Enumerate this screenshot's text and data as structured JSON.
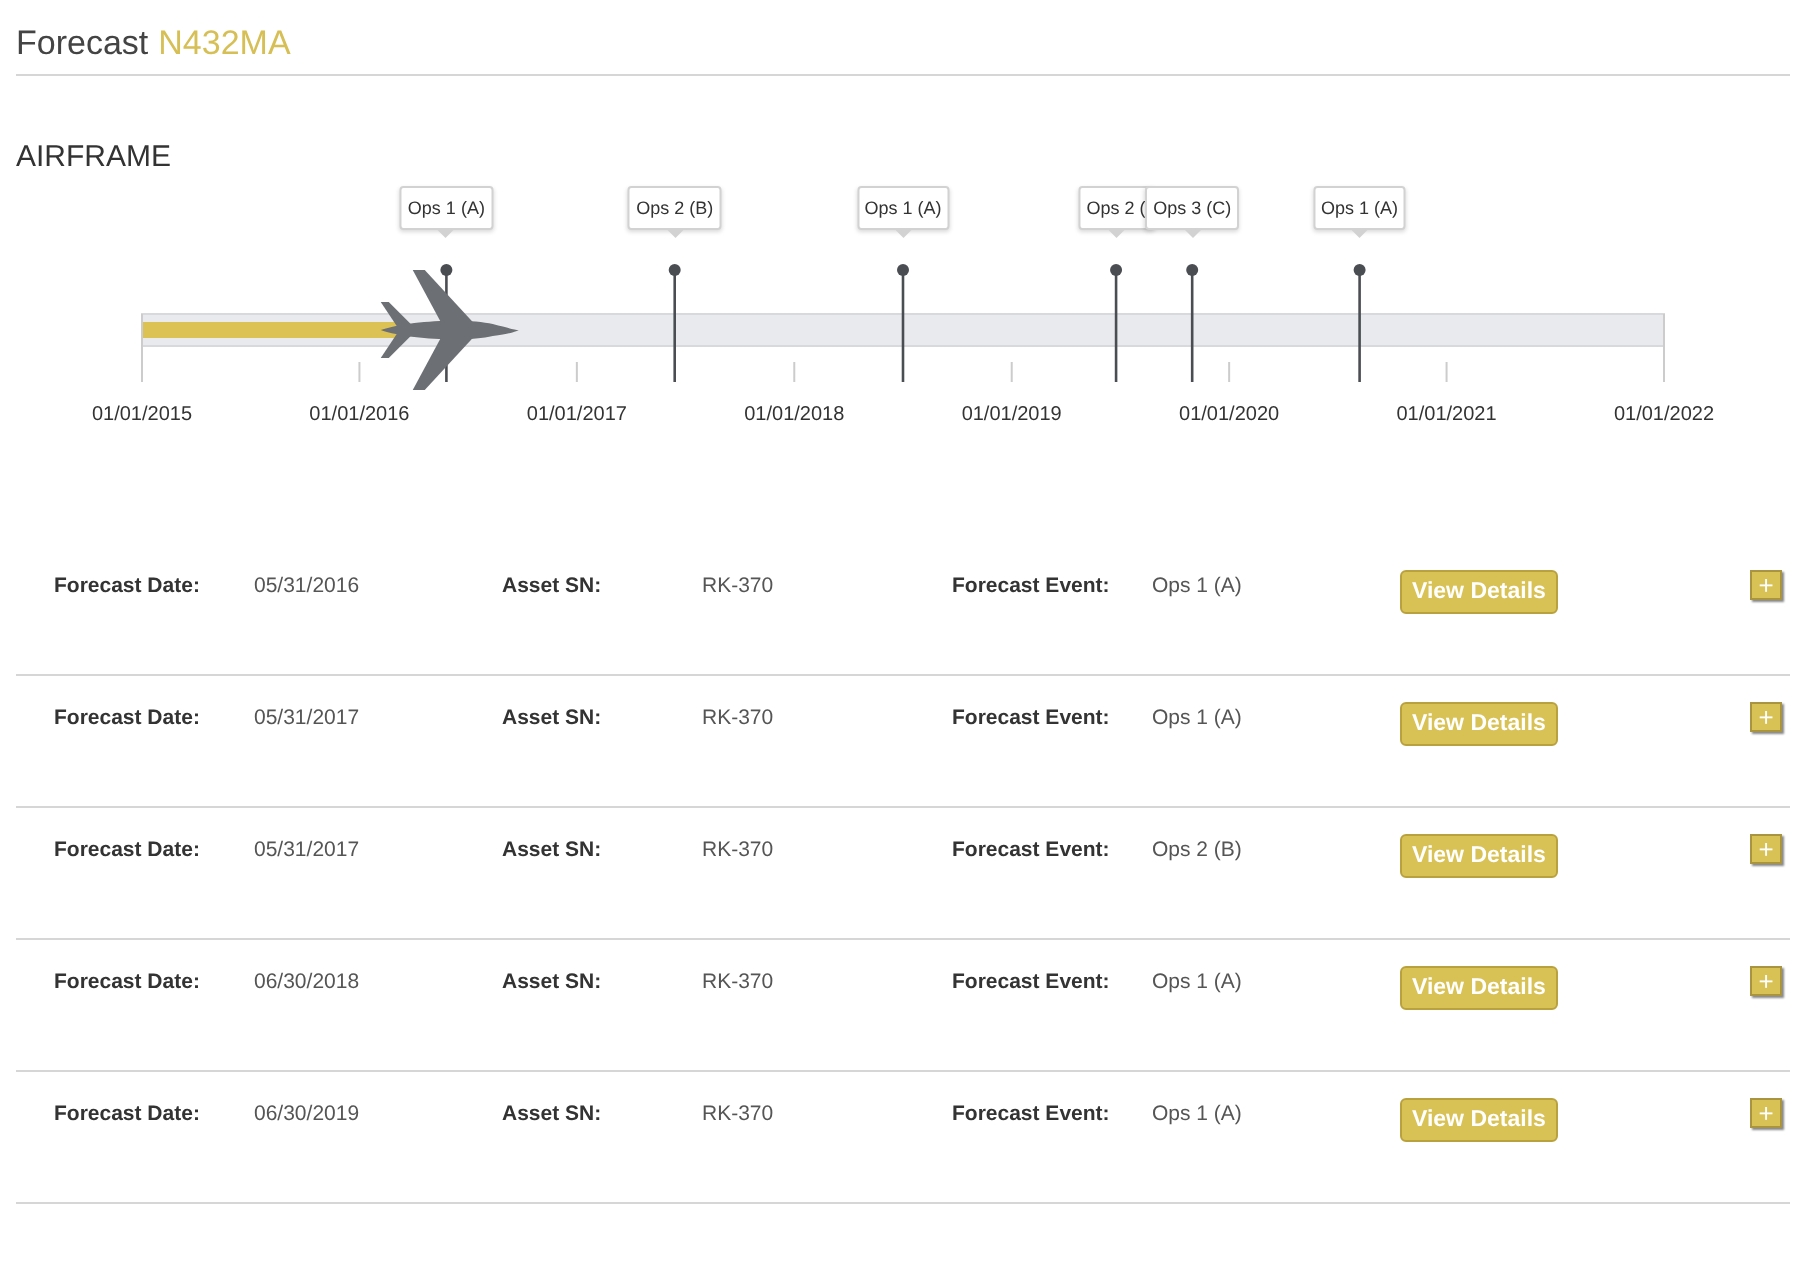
{
  "header": {
    "title": "Forecast",
    "tail_number": "N432MA"
  },
  "section": {
    "title": "AIRFRAME"
  },
  "timeline": {
    "progress": {
      "level": 0.17
    },
    "ticks": [
      "01/01/2015",
      "01/01/2016",
      "01/01/2017",
      "01/01/2018",
      "01/01/2019",
      "01/01/2020",
      "01/01/2021",
      "01/01/2022"
    ],
    "events": [
      {
        "label": "Ops 1 (A)",
        "level": 0.2
      },
      {
        "label": "Ops 2 (B)",
        "level": 0.35
      },
      {
        "label": "Ops 1 (A)",
        "level": 0.5
      },
      {
        "label": "Ops 2 (",
        "level": 0.64
      },
      {
        "label": "Ops 3 (C)",
        "level": 0.69
      },
      {
        "label": "Ops 1 (A)",
        "level": 0.8
      }
    ]
  },
  "rows": [
    {
      "date_label": "Forecast Date:",
      "date": "05/31/2016",
      "asset_label": "Asset SN:",
      "asset": "RK-370",
      "event_label": "Forecast Event:",
      "event": "Ops 1 (A)",
      "button": "View Details",
      "expand": "+"
    },
    {
      "date_label": "Forecast Date:",
      "date": "05/31/2017",
      "asset_label": "Asset SN:",
      "asset": "RK-370",
      "event_label": "Forecast Event:",
      "event": "Ops 1 (A)",
      "button": "View Details",
      "expand": "+"
    },
    {
      "date_label": "Forecast Date:",
      "date": "05/31/2017",
      "asset_label": "Asset SN:",
      "asset": "RK-370",
      "event_label": "Forecast Event:",
      "event": "Ops 2 (B)",
      "button": "View Details",
      "expand": "+"
    },
    {
      "date_label": "Forecast Date:",
      "date": "06/30/2018",
      "asset_label": "Asset SN:",
      "asset": "RK-370",
      "event_label": "Forecast Event:",
      "event": "Ops 1 (A)",
      "button": "View Details",
      "expand": "+"
    },
    {
      "date_label": "Forecast Date:",
      "date": "06/30/2019",
      "asset_label": "Asset SN:",
      "asset": "RK-370",
      "event_label": "Forecast Event:",
      "event": "Ops 1 (A)",
      "button": "View Details",
      "expand": "+"
    }
  ]
}
